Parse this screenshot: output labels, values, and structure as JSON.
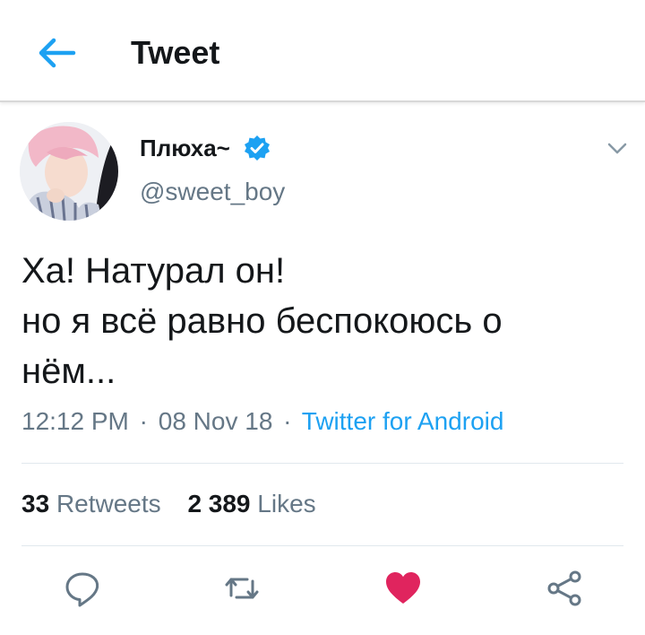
{
  "header": {
    "title": "Tweet"
  },
  "tweet": {
    "display_name": "Плюха~",
    "handle": "@sweet_boy",
    "text_lines": [
      "Ха! Натурал он!",
      "но я всё равно беспокоюсь о",
      "нём..."
    ],
    "time": "12:12 PM",
    "date": "08 Nov 18",
    "source": "Twitter for Android",
    "separator": "·"
  },
  "stats": {
    "retweets_count": "33",
    "retweets_label": "Retweets",
    "likes_count": "2 389",
    "likes_label": "Likes"
  },
  "actions": {
    "liked": true,
    "like_color": "#e0245e",
    "icon_color": "#657786"
  },
  "colors": {
    "accent": "#1da1f2",
    "verified": "#1da1f2"
  },
  "icons": {
    "back": "back-arrow-icon",
    "verified": "verified-badge-icon",
    "caret": "chevron-down-icon",
    "reply": "reply-icon",
    "retweet": "retweet-icon",
    "like": "heart-icon",
    "share": "share-icon"
  }
}
